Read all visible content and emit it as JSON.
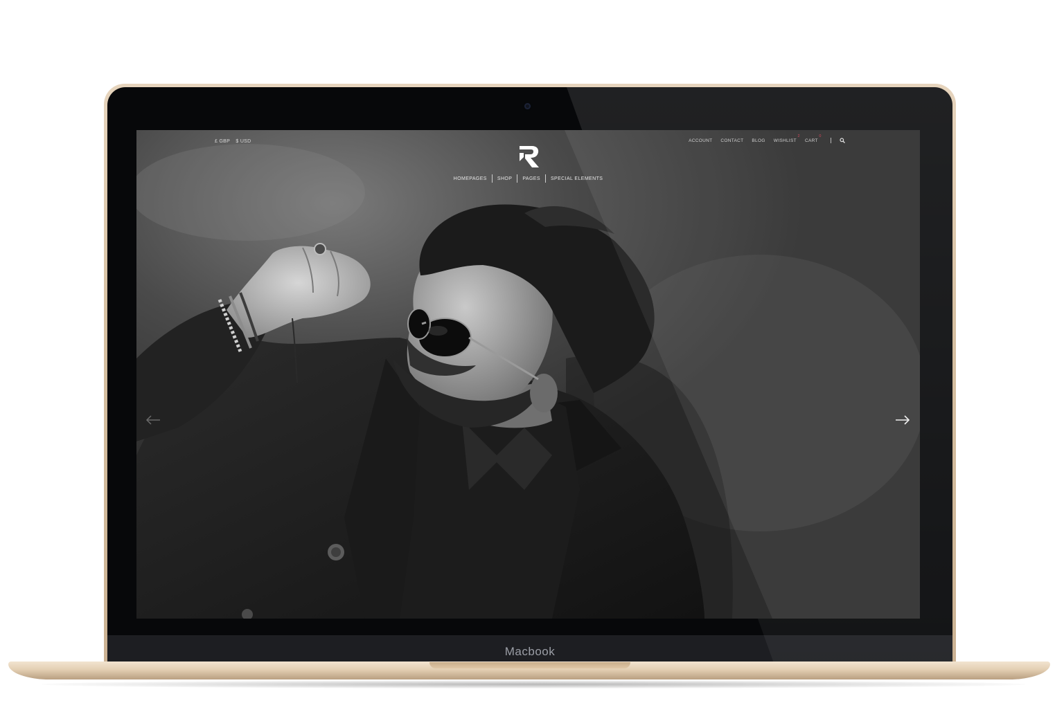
{
  "device": {
    "label": "Macbook"
  },
  "site": {
    "currency": [
      "£ GBP",
      "$ USD"
    ],
    "top_links": {
      "account": "ACCOUNT",
      "contact": "CONTACT",
      "blog": "BLOG",
      "wishlist": "WISHLIST",
      "wishlist_count": "2",
      "cart": "CART",
      "cart_count": "0"
    },
    "main_nav": [
      "HOMEPAGES",
      "SHOP",
      "PAGES",
      "SPECIAL ELEMENTS"
    ],
    "icons": {
      "logo": "r-logo-icon",
      "search": "search-icon",
      "prev": "arrow-left-icon",
      "next": "arrow-right-icon"
    },
    "colors": {
      "badge": "#d0465b",
      "frame_gold": "#d6c0a2"
    }
  },
  "hero": {
    "image": "black-and-white portrait of bearded man wearing aviator sunglasses and dark jacket"
  }
}
